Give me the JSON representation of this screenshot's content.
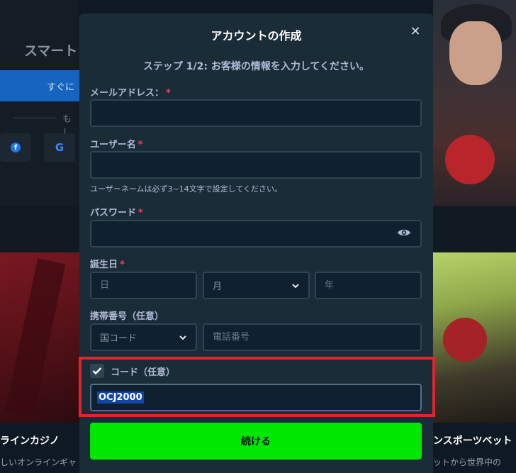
{
  "background": {
    "heading": "スマート",
    "blue_button": "すぐに",
    "or_text": "もし",
    "card_left_title": "ラインカジノ",
    "card_left_sub": "しいオンラインギャ",
    "card_right_title": "ンスポーツベット",
    "card_right_sub": "ットから世界中の"
  },
  "modal": {
    "title": "アカウントの作成",
    "close_glyph": "✕",
    "step": "ステップ 1/2: お客様の情報を入力してください。",
    "email_label": "メールアドレス：",
    "username_label": "ユーザー名",
    "username_hint": "ユーザーネームは必ず3~14文字で設定してください。",
    "password_label": "パスワード",
    "dob_label": "誕生日",
    "dob_day_ph": "日",
    "dob_month_ph": "月",
    "dob_year_ph": "年",
    "phone_label": "携帯番号（任意）",
    "country_code_ph": "国コード",
    "phone_ph": "電話番号",
    "code_label": "コード（任意）",
    "code_value": "OCJ2000",
    "code_checked": true,
    "required_mark": "*",
    "continue_label": "続ける"
  },
  "colors": {
    "modal_bg": "#1a2c38",
    "input_bg": "#0f212e",
    "accent_green": "#00e701",
    "highlight_red": "#e0262c",
    "required_red": "#ed4163"
  }
}
